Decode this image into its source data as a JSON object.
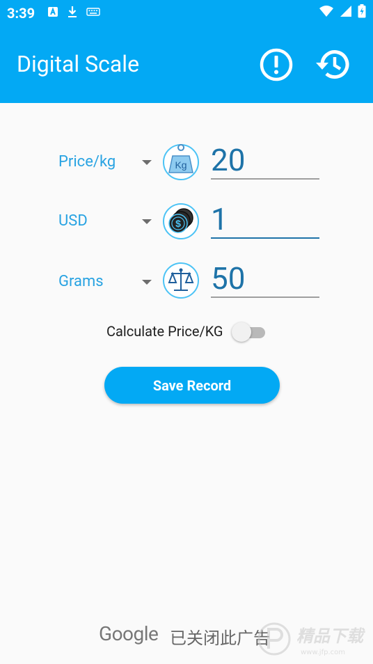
{
  "status_bar": {
    "time": "3:39",
    "left_icons": [
      "font-a-icon",
      "download-icon",
      "keyboard-icon"
    ],
    "right_icons": [
      "wifi-icon",
      "cell-signal-icon",
      "battery-charging-icon"
    ]
  },
  "toolbar": {
    "title": "Digital Scale",
    "actions": [
      "info-icon",
      "history-icon"
    ],
    "color": "#03a9f4"
  },
  "rows": [
    {
      "unit": "Price/kg",
      "icon": "kg-weight-icon",
      "value": "20"
    },
    {
      "unit": "USD",
      "icon": "coins-icon",
      "value": "1"
    },
    {
      "unit": "Grams",
      "icon": "balance-scale-icon",
      "value": "50"
    }
  ],
  "calculate_toggle": {
    "label": "Calculate Price/KG",
    "checked": false
  },
  "save_button": {
    "label": "Save Record"
  },
  "ad_banner": {
    "brand": "Google",
    "status": "已关闭此广告"
  },
  "watermark": {
    "text": "精品下载",
    "subtext": "www.jfp.com"
  }
}
